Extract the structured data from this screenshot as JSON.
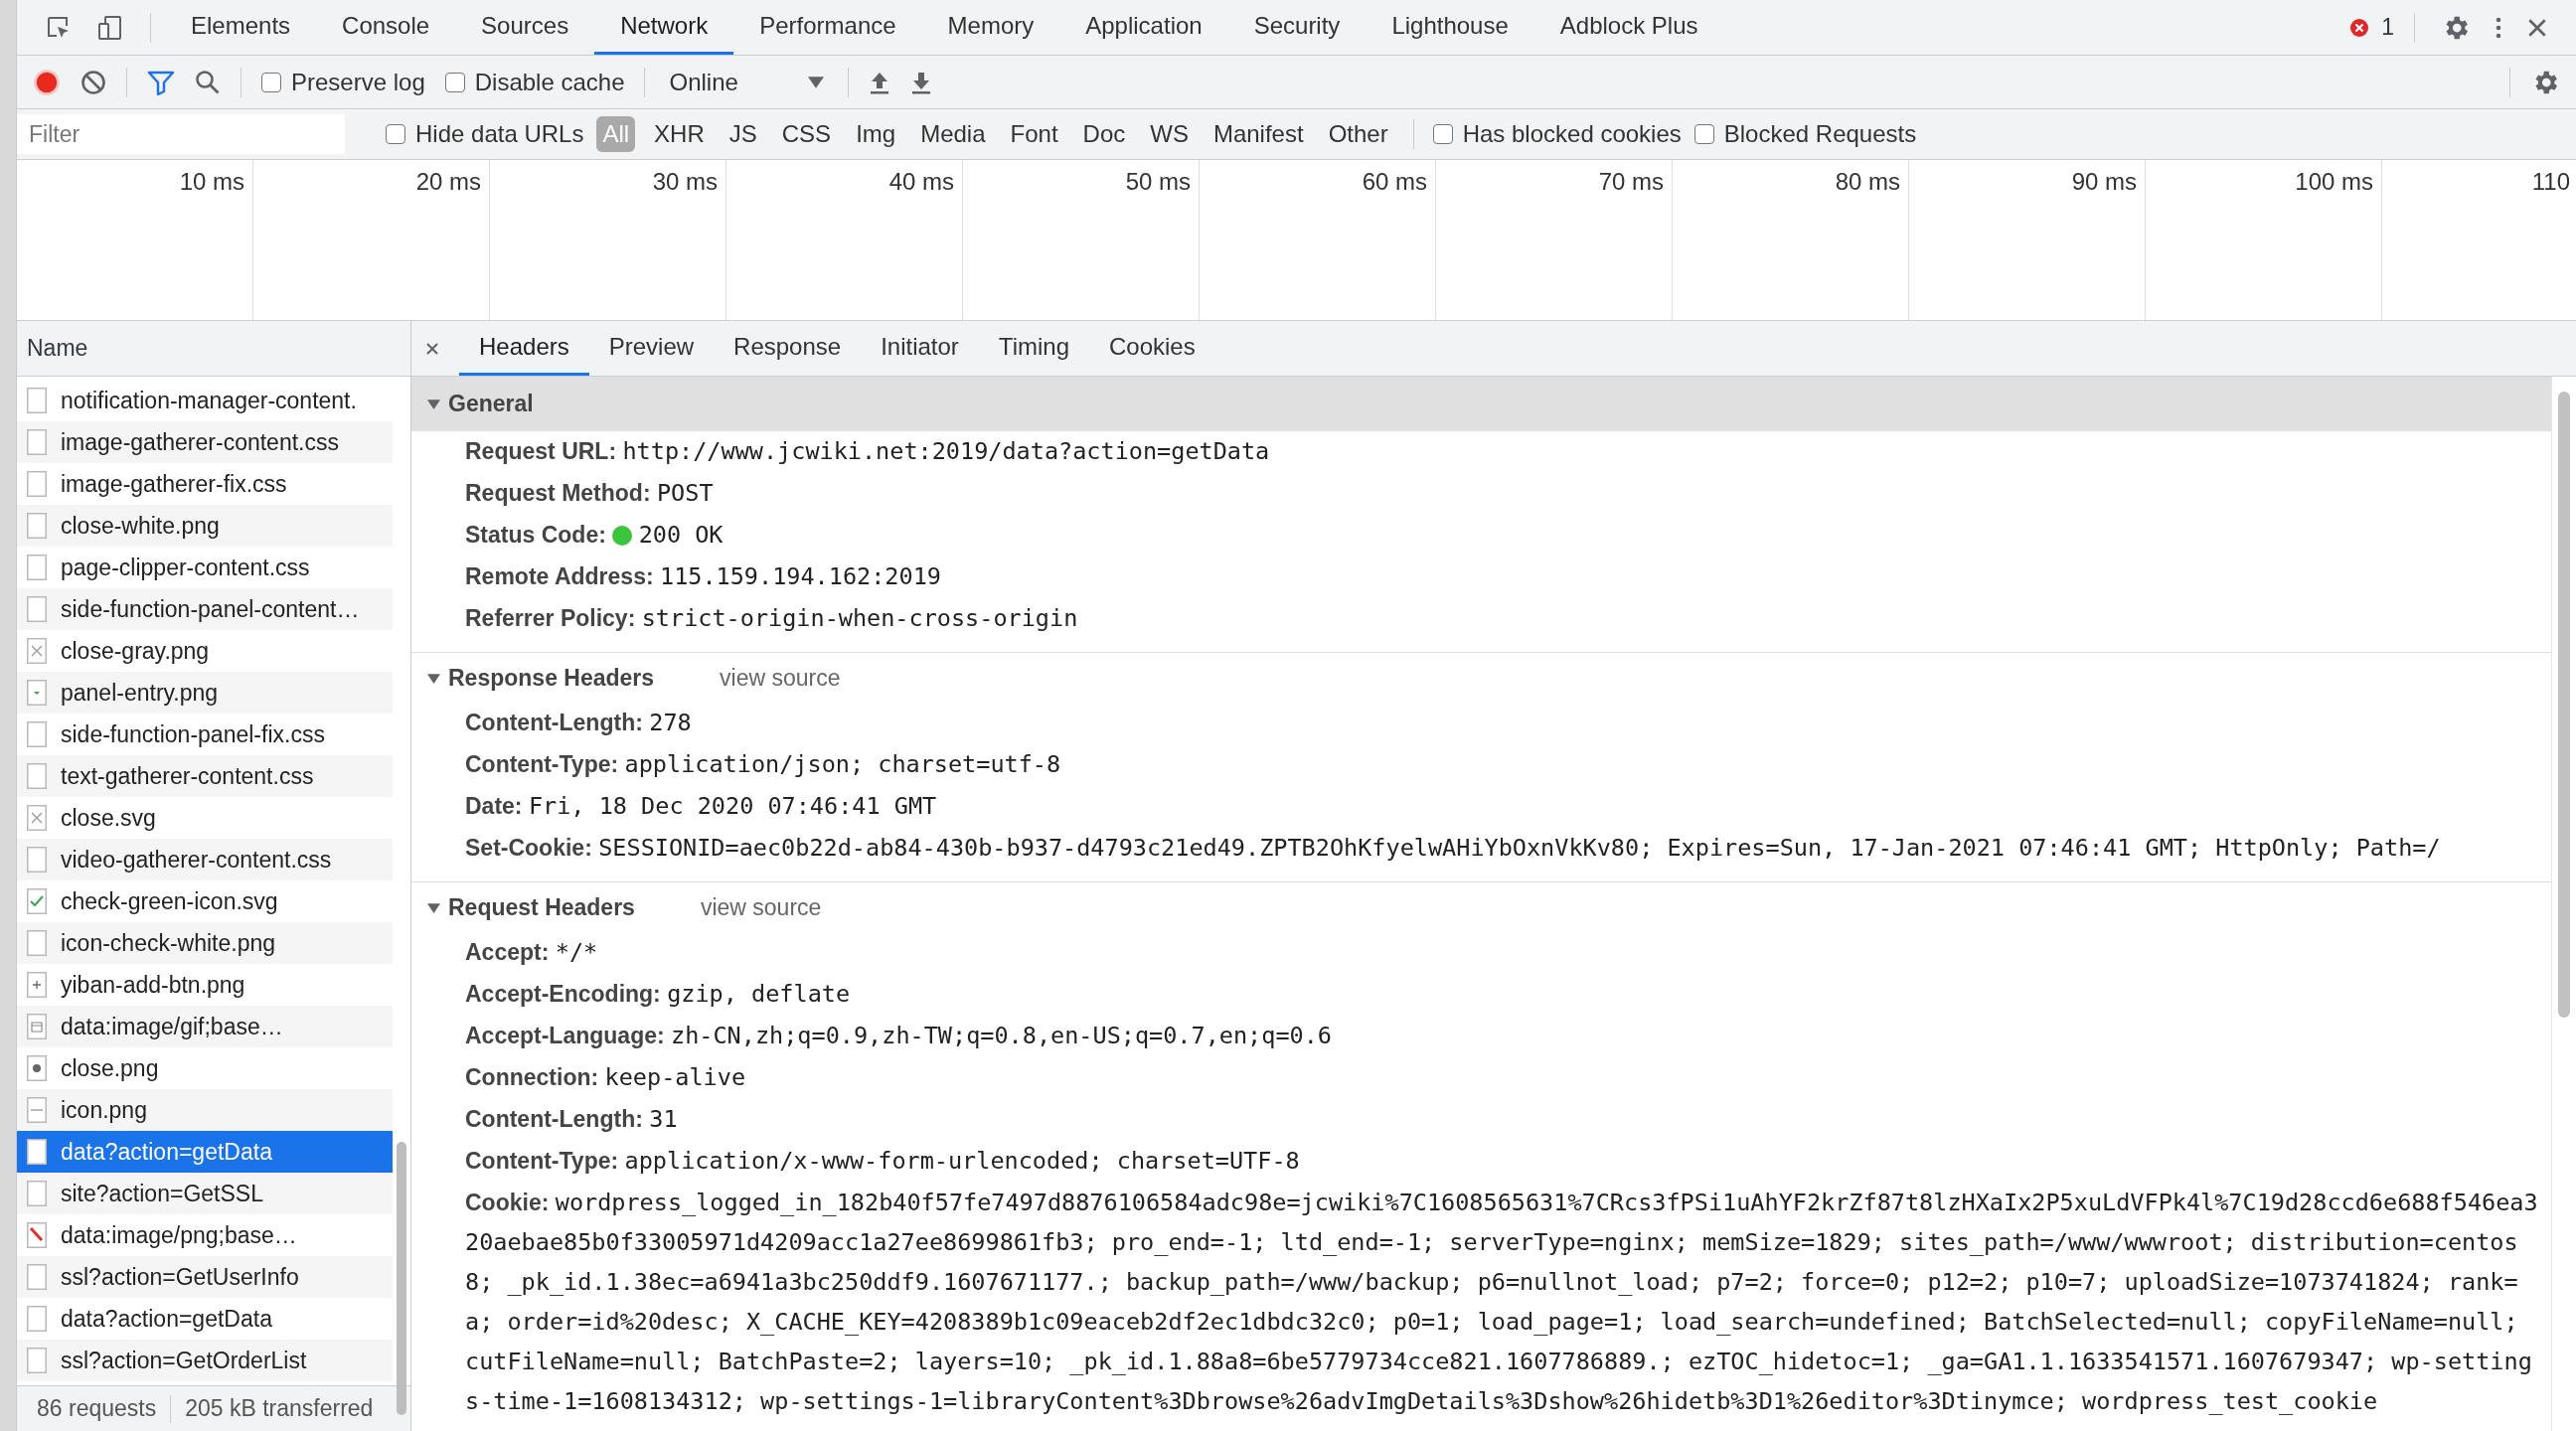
{
  "main_tabs": [
    {
      "label": "Elements",
      "selected": false
    },
    {
      "label": "Console",
      "selected": false
    },
    {
      "label": "Sources",
      "selected": false
    },
    {
      "label": "Network",
      "selected": true
    },
    {
      "label": "Performance",
      "selected": false
    },
    {
      "label": "Memory",
      "selected": false
    },
    {
      "label": "Application",
      "selected": false
    },
    {
      "label": "Security",
      "selected": false
    },
    {
      "label": "Lighthouse",
      "selected": false
    },
    {
      "label": "Adblock Plus",
      "selected": false
    }
  ],
  "error_count": "1",
  "toolbar": {
    "checkboxes": [
      {
        "label": "Preserve log",
        "checked": false
      },
      {
        "label": "Disable cache",
        "checked": false
      }
    ],
    "throttling": "Online"
  },
  "filter_bar": {
    "filter": {
      "placeholder": "Filter"
    },
    "hide_data_urls": {
      "label": "Hide data URLs",
      "checked": false
    },
    "types": [
      {
        "label": "All",
        "selected": true
      },
      {
        "label": "XHR",
        "selected": false
      },
      {
        "label": "JS",
        "selected": false
      },
      {
        "label": "CSS",
        "selected": false
      },
      {
        "label": "Img",
        "selected": false
      },
      {
        "label": "Media",
        "selected": false
      },
      {
        "label": "Font",
        "selected": false
      },
      {
        "label": "Doc",
        "selected": false
      },
      {
        "label": "WS",
        "selected": false
      },
      {
        "label": "Manifest",
        "selected": false
      },
      {
        "label": "Other",
        "selected": false
      }
    ],
    "extra_checkboxes": [
      {
        "label": "Has blocked cookies",
        "checked": false
      },
      {
        "label": "Blocked Requests",
        "checked": false
      }
    ]
  },
  "timeline": {
    "ticks": [
      "10 ms",
      "20 ms",
      "30 ms",
      "40 ms",
      "50 ms",
      "60 ms",
      "70 ms",
      "80 ms",
      "90 ms",
      "100 ms",
      "110"
    ]
  },
  "requests": {
    "column": "Name",
    "rows": [
      {
        "name": "notification-manager-content.",
        "kind": "file",
        "selected": false
      },
      {
        "name": "image-gatherer-content.css",
        "kind": "file",
        "selected": false
      },
      {
        "name": "image-gatherer-fix.css",
        "kind": "file",
        "selected": false
      },
      {
        "name": "close-white.png",
        "kind": "file",
        "selected": false
      },
      {
        "name": "page-clipper-content.css",
        "kind": "file",
        "selected": false
      },
      {
        "name": "side-function-panel-content…",
        "kind": "file",
        "selected": false
      },
      {
        "name": "close-gray.png",
        "kind": "cross",
        "selected": false
      },
      {
        "name": "panel-entry.png",
        "kind": "chevron",
        "selected": false
      },
      {
        "name": "side-function-panel-fix.css",
        "kind": "file",
        "selected": false
      },
      {
        "name": "text-gatherer-content.css",
        "kind": "file",
        "selected": false
      },
      {
        "name": "close.svg",
        "kind": "cross",
        "selected": false
      },
      {
        "name": "video-gatherer-content.css",
        "kind": "file",
        "selected": false
      },
      {
        "name": "check-green-icon.svg",
        "kind": "check",
        "selected": false
      },
      {
        "name": "icon-check-white.png",
        "kind": "file",
        "selected": false
      },
      {
        "name": "yiban-add-btn.png",
        "kind": "plus",
        "selected": false
      },
      {
        "name": "data:image/gif;base…",
        "kind": "frame",
        "selected": false
      },
      {
        "name": "close.png",
        "kind": "dot",
        "selected": false
      },
      {
        "name": "icon.png",
        "kind": "bar",
        "selected": false
      },
      {
        "name": "data?action=getData",
        "kind": "file",
        "selected": true
      },
      {
        "name": "site?action=GetSSL",
        "kind": "file",
        "selected": false
      },
      {
        "name": "data:image/png;base…",
        "kind": "slash",
        "selected": false
      },
      {
        "name": "ssl?action=GetUserInfo",
        "kind": "file",
        "selected": false
      },
      {
        "name": "data?action=getData",
        "kind": "file",
        "selected": false
      },
      {
        "name": "ssl?action=GetOrderList",
        "kind": "file",
        "selected": false
      }
    ]
  },
  "status_bar": {
    "requests": "86 requests",
    "transferred": "205 kB transferred"
  },
  "detail_tabs": [
    {
      "label": "Headers",
      "selected": true
    },
    {
      "label": "Preview",
      "selected": false
    },
    {
      "label": "Response",
      "selected": false
    },
    {
      "label": "Initiator",
      "selected": false
    },
    {
      "label": "Timing",
      "selected": false
    },
    {
      "label": "Cookies",
      "selected": false
    }
  ],
  "sections": [
    {
      "title": "General",
      "expanded": true,
      "highlighted": true,
      "rows": [
        {
          "name": "Request URL:",
          "value": "http://www.jcwiki.net:2019/data?action=getData",
          "kind": "text"
        },
        {
          "name": "Request Method:",
          "value": "POST",
          "kind": "text"
        },
        {
          "name": "Status Code:",
          "value": "200 OK",
          "kind": "status"
        },
        {
          "name": "Remote Address:",
          "value": "115.159.194.162:2019",
          "kind": "text"
        },
        {
          "name": "Referrer Policy:",
          "value": "strict-origin-when-cross-origin",
          "kind": "text"
        }
      ]
    },
    {
      "title": "Response Headers",
      "expanded": true,
      "highlighted": false,
      "link": "view source",
      "rows": [
        {
          "name": "Content-Length:",
          "value": "278",
          "kind": "text"
        },
        {
          "name": "Content-Type:",
          "value": "application/json; charset=utf-8",
          "kind": "text"
        },
        {
          "name": "Date:",
          "value": "Fri, 18 Dec 2020 07:46:41 GMT",
          "kind": "text"
        },
        {
          "name": "Set-Cookie:",
          "value": "SESSIONID=aec0b22d-ab84-430b-b937-d4793c21ed49.ZPTB2OhKfyelwAHiYbOxnVkKv80; Expires=Sun, 17-Jan-2021 07:46:41 GMT; HttpOnly; Path=/",
          "kind": "text"
        }
      ]
    },
    {
      "title": "Request Headers",
      "expanded": true,
      "highlighted": false,
      "link": "view source",
      "rows": [
        {
          "name": "Accept:",
          "value": "*/*",
          "kind": "text"
        },
        {
          "name": "Accept-Encoding:",
          "value": "gzip, deflate",
          "kind": "text"
        },
        {
          "name": "Accept-Language:",
          "value": "zh-CN,zh;q=0.9,zh-TW;q=0.8,en-US;q=0.7,en;q=0.6",
          "kind": "text"
        },
        {
          "name": "Connection:",
          "value": "keep-alive",
          "kind": "text"
        },
        {
          "name": "Content-Length:",
          "value": "31",
          "kind": "text"
        },
        {
          "name": "Content-Type:",
          "value": "application/x-www-form-urlencoded; charset=UTF-8",
          "kind": "text"
        },
        {
          "name": "Cookie:",
          "value": "wordpress_logged_in_182b40f57fe7497d8876106584adc98e=jcwiki%7C1608565631%7CRcs3fPSi1uAhYF2krZf87t8lzHXaIx2P5xuLdVFPk4l%7C19d28ccd6e688f546ea320aebae85b0f33005971d4209acc1a27ee8699861fb3; pro_end=-1; ltd_end=-1; serverType=nginx; memSize=1829; sites_path=/www/wwwroot; distribution=centos8; _pk_id.1.38ec=a6941a3bc250ddf9.1607671177.; backup_path=/www/backup; p6=nullnot_load; p7=2; force=0; p12=2; p10=7; uploadSize=1073741824; rank=a; order=id%20desc; X_CACHE_KEY=4208389b1c09eaceb2df2ec1dbdc32c0; p0=1; load_page=1; load_search=undefined; BatchSelected=null; copyFileName=null; cutFileName=null; BatchPaste=2; layers=10; _pk_id.1.88a8=6be5779734cce821.1607786889.; ezTOC_hidetoc=1; _ga=GA1.1.1633541571.1607679347; wp-settings-time-1=1608134312; wp-settings-1=libraryContent%3Dbrowse%26advImgDetails%3Dshow%26hidetb%3D1%26editor%3Dtinymce; wordpress_test_cookie",
          "kind": "text"
        }
      ]
    }
  ]
}
